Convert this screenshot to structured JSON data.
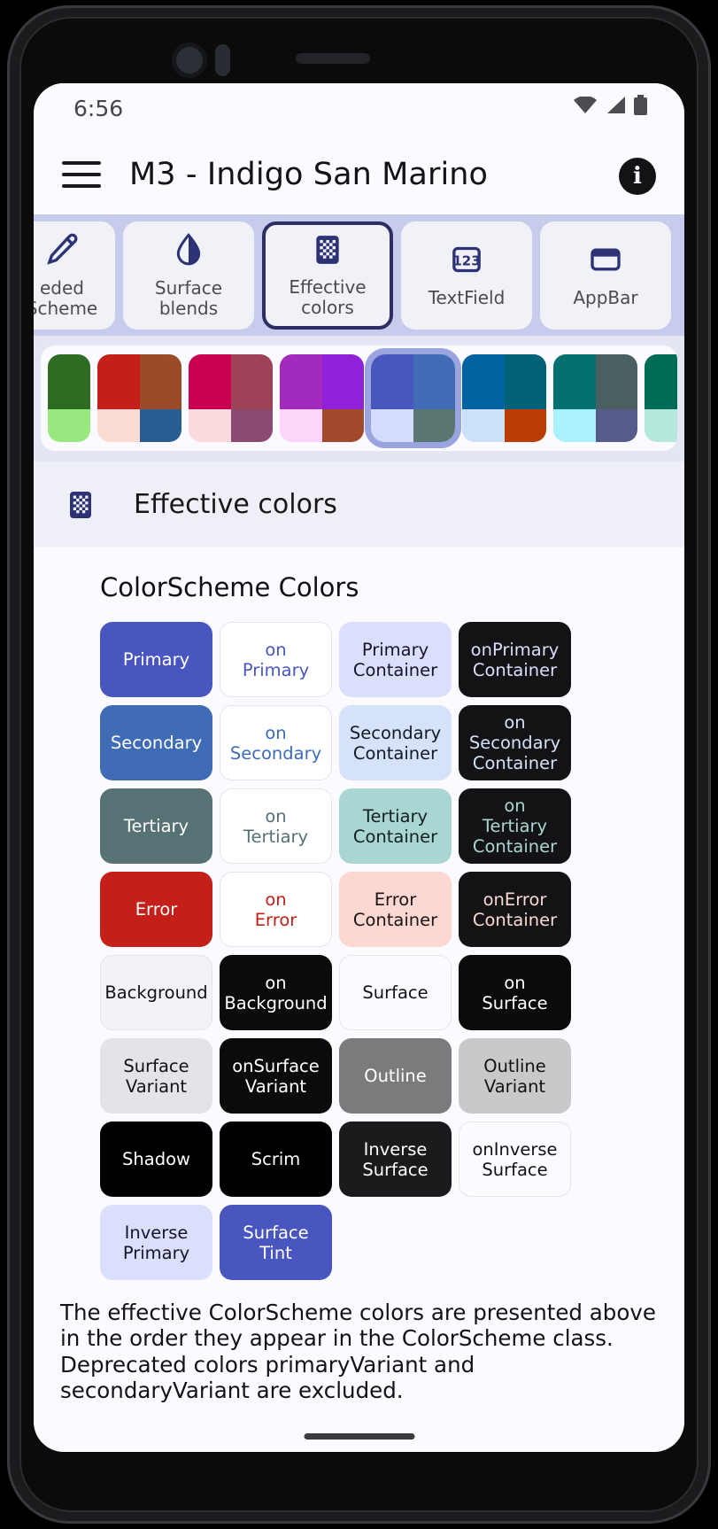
{
  "status_bar": {
    "time": "6:56",
    "icons": [
      "wifi-icon",
      "cellular-signal-icon",
      "battery-icon"
    ]
  },
  "app_bar": {
    "menu_icon": "hamburger-menu-icon",
    "title": "M3 -  Indigo San Marino",
    "info_icon": "info-icon",
    "info_label": "i"
  },
  "tabs": [
    {
      "label": "eded\nScheme",
      "icon": "eyedropper-icon",
      "selected": false,
      "partial": true
    },
    {
      "label": "Surface\nblends",
      "icon": "water-drop-icon",
      "selected": false
    },
    {
      "label": "Effective\ncolors",
      "icon": "checkerboard-icon",
      "selected": true
    },
    {
      "label": "TextField",
      "icon": "numbers-123-icon",
      "selected": false
    },
    {
      "label": "AppBar",
      "icon": "appbar-rectangle-icon",
      "selected": false
    }
  ],
  "theme_selector": {
    "selected_index": 5,
    "themes": [
      {
        "name": "theme-green",
        "quadrants": [
          "#2f6b22",
          "#596b56",
          "#96e87f",
          "#1d7168"
        ],
        "narrow": true
      },
      {
        "name": "theme-red",
        "quadrants": [
          "#c41f19",
          "#9b4b27",
          "#fbdcd2",
          "#285e92"
        ]
      },
      {
        "name": "theme-pink",
        "quadrants": [
          "#c8004f",
          "#9e4257",
          "#fbdade",
          "#8a4a74"
        ]
      },
      {
        "name": "theme-purple",
        "quadrants": [
          "#a22bbd",
          "#8f22d8",
          "#fcd5fb",
          "#a34a2c"
        ]
      },
      {
        "name": "theme-indigo-san-marino",
        "quadrants": [
          "#4a56bf",
          "#3f6cb4",
          "#d5dcfb",
          "#5a7672"
        ],
        "selected": true
      },
      {
        "name": "theme-blue",
        "quadrants": [
          "#0062a0",
          "#016277",
          "#cbe0f9",
          "#bb3d05"
        ]
      },
      {
        "name": "theme-teal",
        "quadrants": [
          "#04716f",
          "#4a5f61",
          "#aaf1fb",
          "#585c8b"
        ]
      },
      {
        "name": "theme-green-dark",
        "quadrants": [
          "#016b55",
          "#46615f",
          "#b6e7dc",
          "#3d6077"
        ]
      }
    ]
  },
  "section": {
    "icon": "checkerboard-icon",
    "title": "Effective colors"
  },
  "content": {
    "heading": "ColorScheme Colors",
    "swatches": [
      {
        "label": "Primary",
        "bg": "#4a56bf",
        "fg": "#ffffff"
      },
      {
        "label": "on\nPrimary",
        "bg": "#ffffff",
        "fg": "#4a56bf",
        "bordered": true
      },
      {
        "label": "Primary\nContainer",
        "bg": "#dbdffb",
        "fg": "#14142b"
      },
      {
        "label": "onPrimary\nContainer",
        "bg": "#131316",
        "fg": "#dbdffb"
      },
      {
        "label": "Secondary",
        "bg": "#3f6cb4",
        "fg": "#ffffff"
      },
      {
        "label": "on\nSecondary",
        "bg": "#ffffff",
        "fg": "#3f6cb4",
        "bordered": true
      },
      {
        "label": "Secondary\nContainer",
        "bg": "#d5e2f8",
        "fg": "#13182b"
      },
      {
        "label": "on\nSecondary\nContainer",
        "bg": "#131316",
        "fg": "#d5e2f8"
      },
      {
        "label": "Tertiary",
        "bg": "#567274",
        "fg": "#ffffff"
      },
      {
        "label": "on\nTertiary",
        "bg": "#ffffff",
        "fg": "#567274",
        "bordered": true
      },
      {
        "label": "Tertiary\nContainer",
        "bg": "#a9d6d3",
        "fg": "#13201f"
      },
      {
        "label": "on\nTertiary\nContainer",
        "bg": "#131316",
        "fg": "#a9d6d3"
      },
      {
        "label": "Error",
        "bg": "#c41f19",
        "fg": "#ffffff"
      },
      {
        "label": "on\nError",
        "bg": "#ffffff",
        "fg": "#c41f19",
        "bordered": true
      },
      {
        "label": "Error\nContainer",
        "bg": "#fbd8d2",
        "fg": "#1c1313"
      },
      {
        "label": "onError\nContainer",
        "bg": "#131316",
        "fg": "#fbd8d2"
      },
      {
        "label": "Background",
        "bg": "#f3f2f8",
        "fg": "#121214",
        "bordered": true
      },
      {
        "label": "on\nBackground",
        "bg": "#0b0b0c",
        "fg": "#ffffff"
      },
      {
        "label": "Surface",
        "bg": "#fbfaff",
        "fg": "#121214",
        "bordered": true
      },
      {
        "label": "on\nSurface",
        "bg": "#0b0b0c",
        "fg": "#ffffff"
      },
      {
        "label": "Surface\nVariant",
        "bg": "#e3e3e8",
        "fg": "#121214"
      },
      {
        "label": "onSurface\nVariant",
        "bg": "#0b0b0c",
        "fg": "#ffffff"
      },
      {
        "label": "Outline",
        "bg": "#7b7b7d",
        "fg": "#ffffff"
      },
      {
        "label": "Outline\nVariant",
        "bg": "#c9c9cb",
        "fg": "#121214"
      },
      {
        "label": "Shadow",
        "bg": "#000000",
        "fg": "#ffffff"
      },
      {
        "label": "Scrim",
        "bg": "#000000",
        "fg": "#ffffff"
      },
      {
        "label": "Inverse\nSurface",
        "bg": "#1b1b1d",
        "fg": "#ffffff"
      },
      {
        "label": "onInverse\nSurface",
        "bg": "#fbfaff",
        "fg": "#121214",
        "bordered": true
      },
      {
        "label": "Inverse\nPrimary",
        "bg": "#dbdffb",
        "fg": "#14142b"
      },
      {
        "label": "Surface\nTint",
        "bg": "#4a56bf",
        "fg": "#ffffff"
      }
    ],
    "footer": "The effective ColorScheme colors are presented above in the order they appear in the ColorScheme class. Deprecated colors primaryVariant and secondaryVariant are excluded."
  }
}
